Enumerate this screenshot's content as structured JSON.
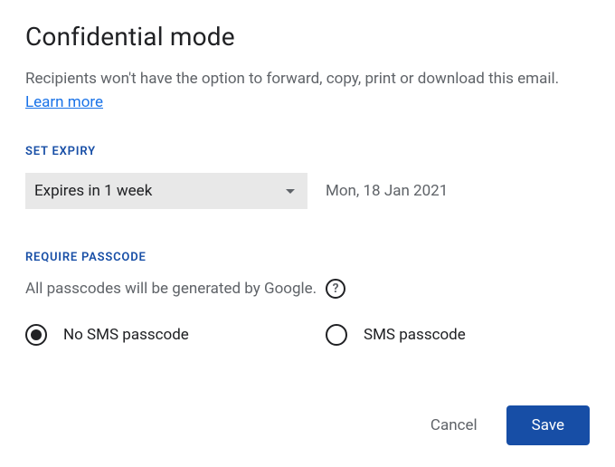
{
  "title": "Confidential mode",
  "description": {
    "text": "Recipients won't have the option to forward, copy, print or download this email. ",
    "link": "Learn more"
  },
  "expiry": {
    "label": "SET EXPIRY",
    "selected": "Expires in 1 week",
    "date": "Mon, 18 Jan 2021"
  },
  "passcode": {
    "label": "REQUIRE PASSCODE",
    "subtext": "All passcodes will be generated by Google.",
    "help_glyph": "?",
    "options": {
      "no_sms": "No SMS passcode",
      "sms": "SMS passcode"
    }
  },
  "footer": {
    "cancel": "Cancel",
    "save": "Save"
  }
}
